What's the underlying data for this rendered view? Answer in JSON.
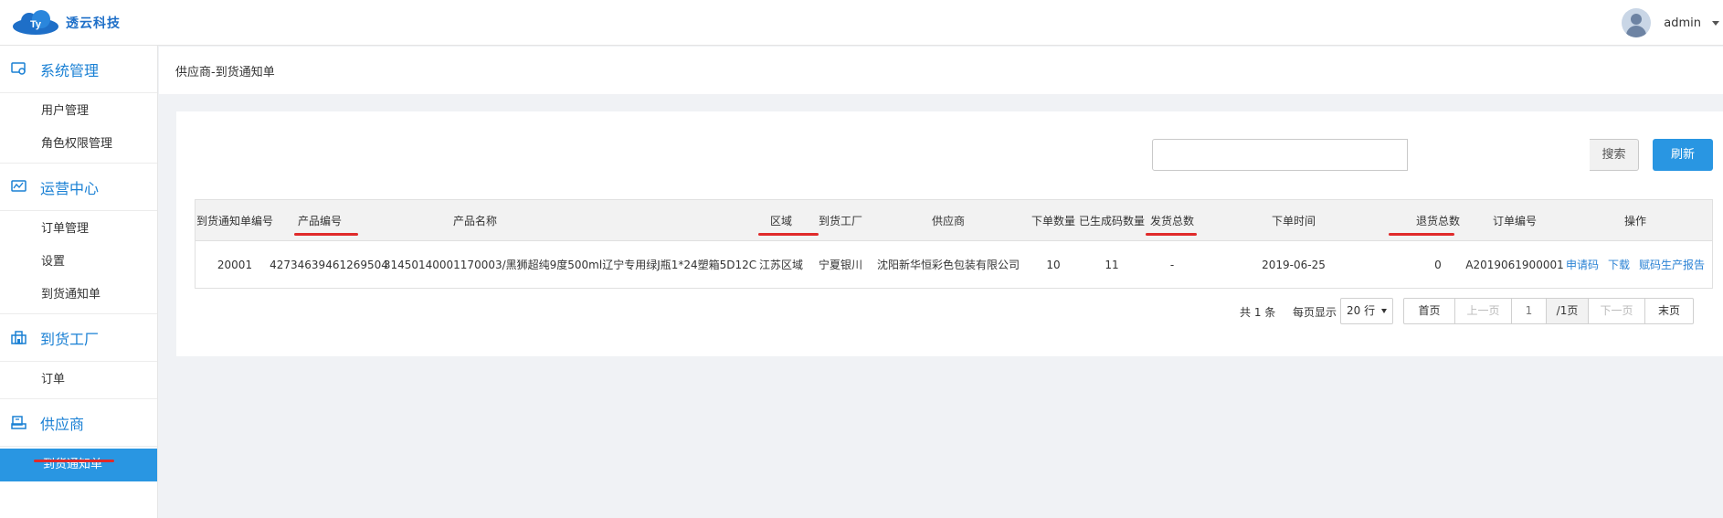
{
  "header": {
    "brand": "透云科技",
    "logo_badge": "Ty",
    "username": "admin"
  },
  "sidebar": {
    "groups": [
      {
        "label": "系统管理",
        "icon": "settings-screen-icon",
        "items": [
          "用户管理",
          "角色权限管理"
        ]
      },
      {
        "label": "运营中心",
        "icon": "monitor-chart-icon",
        "items": [
          "订单管理",
          "设置",
          "到货通知单"
        ]
      },
      {
        "label": "到货工厂",
        "icon": "building-icon",
        "items": [
          "订单"
        ]
      },
      {
        "label": "供应商",
        "icon": "supplier-icon",
        "items": [
          "到货通知单"
        ]
      }
    ],
    "active_item": "到货通知单"
  },
  "breadcrumb": "供应商-到货通知单",
  "toolbar": {
    "search_value": "",
    "search_label": "搜索",
    "refresh_label": "刷新"
  },
  "table": {
    "headers": [
      "到货通知单编号",
      "产品编号",
      "产品名称",
      "区域",
      "到货工厂",
      "供应商",
      "下单数量",
      "已生成码数量",
      "发货总数",
      "下单时间",
      "退货总数",
      "订单编号",
      "操作"
    ],
    "rows": [
      {
        "id": "20001",
        "product_code": "42734639461269504",
        "product_name": "31450140001170003/黑狮超纯9度500ml辽宁专用绿J瓶1*24塑箱5D12C",
        "region": "江苏区域",
        "factory": "宁夏银川",
        "supplier": "沈阳新华恒彩色包装有限公司",
        "order_qty": "10",
        "generated_qty": "11",
        "shipped_total": "-",
        "order_time": "2019-06-25",
        "return_total": "0",
        "order_no": "A2019061900001",
        "actions": [
          "申请码",
          "下载",
          "赋码生产报告"
        ]
      }
    ]
  },
  "pagination": {
    "total": "共 1 条",
    "per_page_label": "每页显示",
    "per_page_value": "20 行",
    "first": "首页",
    "prev": "上一页",
    "current": "1",
    "pages": "/1页",
    "next": "下一页",
    "last": "末页"
  },
  "colors": {
    "accent": "#2996e2",
    "annotation": "#e02a2a",
    "link": "#2a82d4"
  }
}
